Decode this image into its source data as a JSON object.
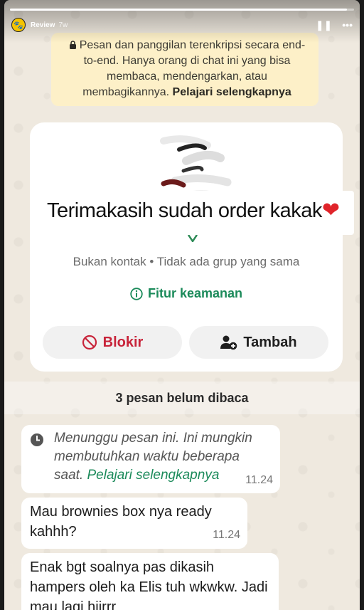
{
  "story": {
    "username": "Review",
    "time_ago": "7w",
    "progress": 0.98,
    "pause_icon": "pause-icon",
    "more_icon": "more-icon"
  },
  "chat": {
    "encryption_notice": "Pesan dan panggilan terenkripsi secara end-to-end. Hanya orang di chat ini yang bisa membaca, mendengarkan, atau membagikannya.",
    "encryption_learn_more": "Pelajari selengkapnya",
    "sticker_text": "Terimakasih sudah order kakak",
    "contact_info": "Bukan kontak • Tidak ada grup yang sama",
    "security_features": "Fitur keamanan",
    "block_button": "Blokir",
    "add_button": "Tambah",
    "unread_banner": "3 pesan belum dibaca",
    "messages": [
      {
        "text": "Menunggu pesan ini. Ini mungkin membutuhkan waktu beberapa saat.",
        "link": "Pelajari selengkapnya",
        "time": "11.24"
      },
      {
        "text": "Mau brownies box nya ready kahhh?",
        "time": "11.24"
      },
      {
        "text": "Enak bgt soalnya pas dikasih hampers oleh ka Elis tuh wkwkw. Jadi mau lagi hiirrr"
      }
    ]
  },
  "colors": {
    "chat_bg": "#efe9df",
    "notice_bg": "#fdf0c8",
    "green_accent": "#1b8a5a",
    "block_red": "#c8243a",
    "heart_red": "#e0242a"
  }
}
